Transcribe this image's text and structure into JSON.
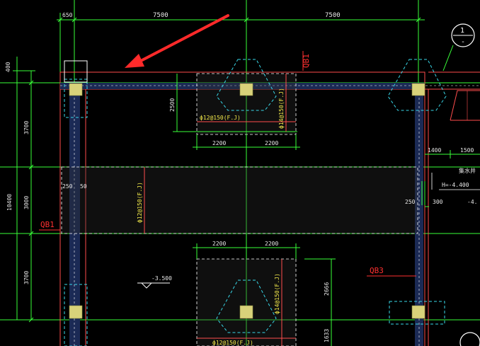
{
  "drawing": {
    "background": "#000000",
    "colors": {
      "grid_line": "#39ff39",
      "dim_line": "#39ff39",
      "dim_text": "#e8e8e8",
      "beam_edge": "#ff4d4d",
      "beam_fill": "#1b2a55",
      "column_fill": "#d8d27a",
      "cyan": "#38d7e8",
      "white": "#ffffff",
      "red_text": "#ff3030",
      "yellow_text": "#f2e84a",
      "arrow": "#ff2a2a"
    },
    "top_dims": {
      "left_margin": "650",
      "bay1": "7500",
      "bay2": "7500"
    },
    "left_dims": {
      "top_offset": "400",
      "seg1": "3700",
      "seg2": "3000",
      "seg3": "3700",
      "total": "10400"
    },
    "slab_upper": {
      "dim_height": "2500",
      "rebar_h": "ф12@150(F.J)",
      "rebar_v": "ф14@150(F.J)",
      "dim_w1": "2200",
      "dim_w2": "2200"
    },
    "slab_middle": {
      "rebar_v": "ф12@150(F.J)",
      "dim_left_a": "250",
      "dim_left_b": "50",
      "dim_right": "250",
      "dim_right_b": "300"
    },
    "slab_lower": {
      "dim_w1": "2200",
      "dim_w2": "2200",
      "rebar_v": "ф14@150(F.J)",
      "rebar_h": "ф12@150(F.J)",
      "dim_height": "2666",
      "dim_height_b": "1633"
    },
    "labels": {
      "qb1_top": "QB1",
      "qb1_left": "QB1",
      "qb3": "QB3",
      "elevation_mid": "-3.500",
      "right_dim_a": "1400",
      "right_dim_b": "1500",
      "right_note": "集水井",
      "right_elev": "H=-4.400",
      "right_elev_b": "-4."
    },
    "axis_markers": {
      "top_right": "1",
      "top_right_sub": "-"
    }
  }
}
